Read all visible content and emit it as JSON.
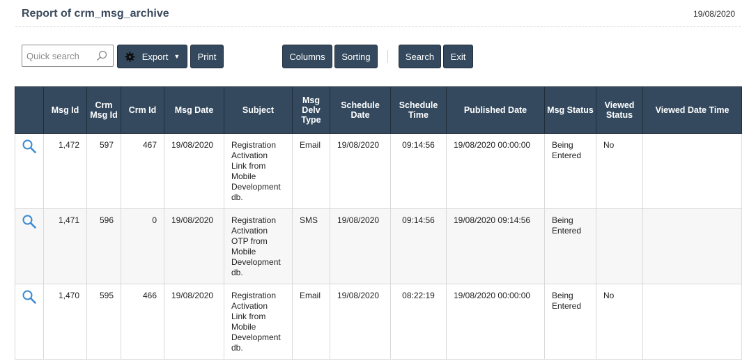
{
  "header": {
    "title": "Report of crm_msg_archive",
    "date": "19/08/2020"
  },
  "toolbar": {
    "search_placeholder": "Quick search",
    "export_label": "Export",
    "print_label": "Print",
    "columns_label": "Columns",
    "sorting_label": "Sorting",
    "search_label": "Search",
    "exit_label": "Exit"
  },
  "colors": {
    "header_bg": "#34495e",
    "icon": "#3a8ad0"
  },
  "table": {
    "columns": [
      "",
      "Msg Id",
      "Crm Msg Id",
      "Crm Id",
      "Msg Date",
      "Subject",
      "Msg Delv Type",
      "Schedule Date",
      "Schedule Time",
      "Published Date",
      "Msg Status",
      "Viewed Status",
      "Viewed Date Time"
    ],
    "rows": [
      {
        "msg_id": "1,472",
        "crm_msg_id": "597",
        "crm_id": "467",
        "msg_date": "19/08/2020",
        "subject": "Registration Activation Link from Mobile Development db.",
        "delv_type": "Email",
        "schedule_date": "19/08/2020",
        "schedule_time": "09:14:56",
        "published_date": "19/08/2020 00:00:00",
        "msg_status": "Being Entered",
        "viewed_status": "No",
        "viewed_date_time": ""
      },
      {
        "msg_id": "1,471",
        "crm_msg_id": "596",
        "crm_id": "0",
        "msg_date": "19/08/2020",
        "subject": "Registration Activation OTP from Mobile Development db.",
        "delv_type": "SMS",
        "schedule_date": "19/08/2020",
        "schedule_time": "09:14:56",
        "published_date": "19/08/2020 09:14:56",
        "msg_status": "Being Entered",
        "viewed_status": "",
        "viewed_date_time": ""
      },
      {
        "msg_id": "1,470",
        "crm_msg_id": "595",
        "crm_id": "466",
        "msg_date": "19/08/2020",
        "subject": "Registration Activation Link from Mobile Development db.",
        "delv_type": "Email",
        "schedule_date": "19/08/2020",
        "schedule_time": "08:22:19",
        "published_date": "19/08/2020 00:00:00",
        "msg_status": "Being Entered",
        "viewed_status": "No",
        "viewed_date_time": ""
      }
    ]
  }
}
